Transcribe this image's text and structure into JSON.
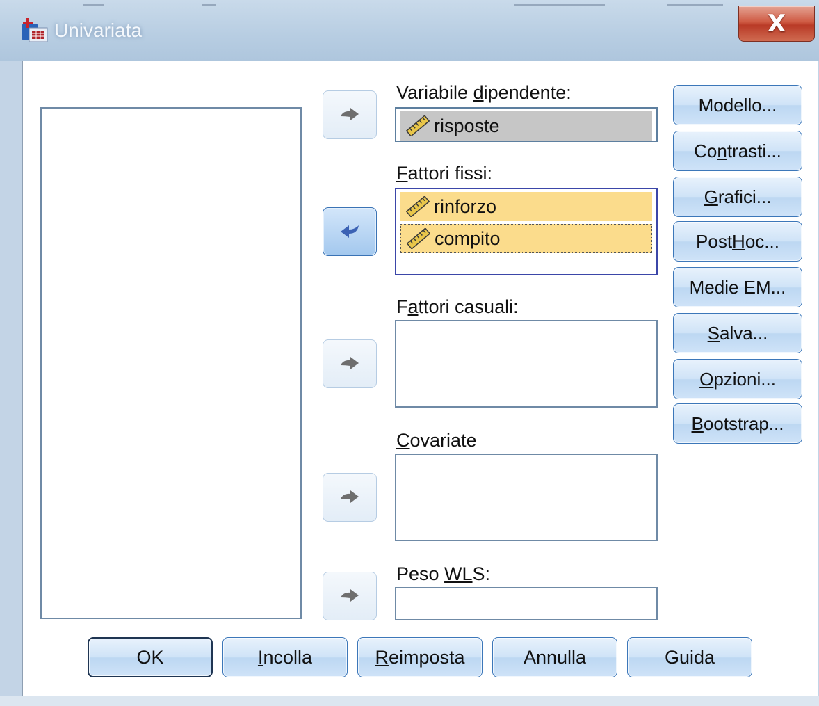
{
  "window": {
    "title": "Univariata",
    "close_label": "X"
  },
  "arrow_buttons": [
    {
      "target": "dependent",
      "active": false
    },
    {
      "target": "fixed_factors",
      "active": true
    },
    {
      "target": "random_factors",
      "active": false
    },
    {
      "target": "covariates",
      "active": false
    },
    {
      "target": "wls_weight",
      "active": false
    }
  ],
  "dependent": {
    "label_pre": "Variabile ",
    "label_key": "d",
    "label_post": "ipendente:",
    "value": "risposte"
  },
  "fixed_factors": {
    "label_pre": "",
    "label_key": "F",
    "label_post": "attori fissi:",
    "items": [
      "rinforzo",
      "compito"
    ]
  },
  "random_factors": {
    "label_pre": "F",
    "label_key": "a",
    "label_post": "ttori casuali:"
  },
  "covariates": {
    "label_pre": "",
    "label_key": "C",
    "label_post": "ovariate"
  },
  "wls_weight": {
    "label_pre": "Peso ",
    "label_key": "WL",
    "label_post": "S:"
  },
  "side_buttons": [
    {
      "pre": "Modello...",
      "key": "",
      "post": ""
    },
    {
      "pre": "Co",
      "key": "n",
      "post": "trasti..."
    },
    {
      "pre": "",
      "key": "G",
      "post": "rafici..."
    },
    {
      "pre": "Post ",
      "key": "H",
      "post": "oc..."
    },
    {
      "pre": "Medie EM...",
      "key": "",
      "post": ""
    },
    {
      "pre": "",
      "key": "S",
      "post": "alva..."
    },
    {
      "pre": "",
      "key": "O",
      "post": "pzioni..."
    },
    {
      "pre": "",
      "key": "B",
      "post": "ootstrap..."
    }
  ],
  "bottom_buttons": [
    {
      "pre": "OK",
      "key": "",
      "post": ""
    },
    {
      "pre": "",
      "key": "I",
      "post": "ncolla"
    },
    {
      "pre": "",
      "key": "R",
      "post": "eimposta"
    },
    {
      "pre": "Annulla",
      "key": "",
      "post": ""
    },
    {
      "pre": "Guida",
      "key": "",
      "post": ""
    }
  ],
  "colors": {
    "selected_bg": "#fbdc8c",
    "dependent_bg": "#c6c6c6",
    "arrow_active": "#3b62b4",
    "arrow_inactive": "#6e6e6e"
  },
  "icons": {
    "variable": "ruler-icon",
    "arrow": "curved-arrow-right-icon",
    "arrow_back": "curved-arrow-left-icon"
  }
}
